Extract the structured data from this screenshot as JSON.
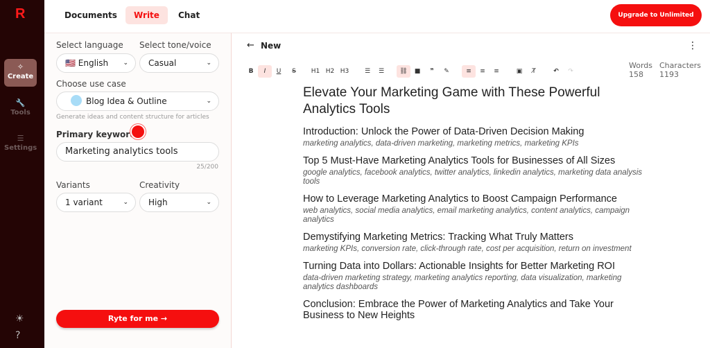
{
  "app": {
    "logo": "R"
  },
  "sidebar": {
    "items": [
      {
        "label": "Create",
        "icon": "sparkles-icon"
      },
      {
        "label": "Tools",
        "icon": "wrench-icon"
      },
      {
        "label": "Settings",
        "icon": "sliders-icon"
      }
    ]
  },
  "top": {
    "tabs": [
      "Documents",
      "Write",
      "Chat"
    ],
    "upgrade": "Upgrade to Unlimited"
  },
  "form": {
    "language_label": "Select language",
    "language": "English",
    "tone_label": "Select tone/voice",
    "tone": "Casual",
    "usecase_label": "Choose use case",
    "usecase": "Blog Idea & Outline",
    "usecase_hint": "Generate ideas and content structure for articles",
    "keyword_label": "Primary keyword",
    "keyword": "Marketing analytics tools",
    "keyword_count": "25/200",
    "variants_label": "Variants",
    "variants": "1 variant",
    "creativity_label": "Creativity",
    "creativity": "High",
    "submit": "Ryte for me →"
  },
  "editor": {
    "title": "New",
    "toolbar": [
      "B",
      "I",
      "U",
      "S",
      "H1",
      "H2",
      "H3"
    ],
    "words_label": "Words",
    "words": "158",
    "chars_label": "Characters",
    "chars": "1193",
    "doc_title": "Elevate Your Marketing Game with These Powerful Analytics Tools",
    "sections": [
      {
        "h": "Introduction: Unlock the Power of Data-Driven Decision Making",
        "k": "marketing analytics, data-driven marketing, marketing metrics, marketing KPIs"
      },
      {
        "h": "Top 5 Must-Have Marketing Analytics Tools for Businesses of All Sizes",
        "k": "google analytics, facebook analytics, twitter analytics, linkedin analytics, marketing data analysis tools"
      },
      {
        "h": "How to Leverage Marketing Analytics to Boost Campaign Performance",
        "k": "web analytics, social media analytics, email marketing analytics, content analytics, campaign analytics"
      },
      {
        "h": "Demystifying Marketing Metrics: Tracking What Truly Matters",
        "k": "marketing KPIs, conversion rate, click-through rate, cost per acquisition, return on investment"
      },
      {
        "h": "Turning Data into Dollars: Actionable Insights for Better Marketing ROI",
        "k": "data-driven marketing strategy, marketing analytics reporting, data visualization, marketing analytics dashboards"
      },
      {
        "h": "Conclusion: Embrace the Power of Marketing Analytics and Take Your Business to New Heights",
        "k": ""
      }
    ]
  },
  "colors": {
    "accent": "#f50f0f",
    "sidebar": "#240505"
  }
}
